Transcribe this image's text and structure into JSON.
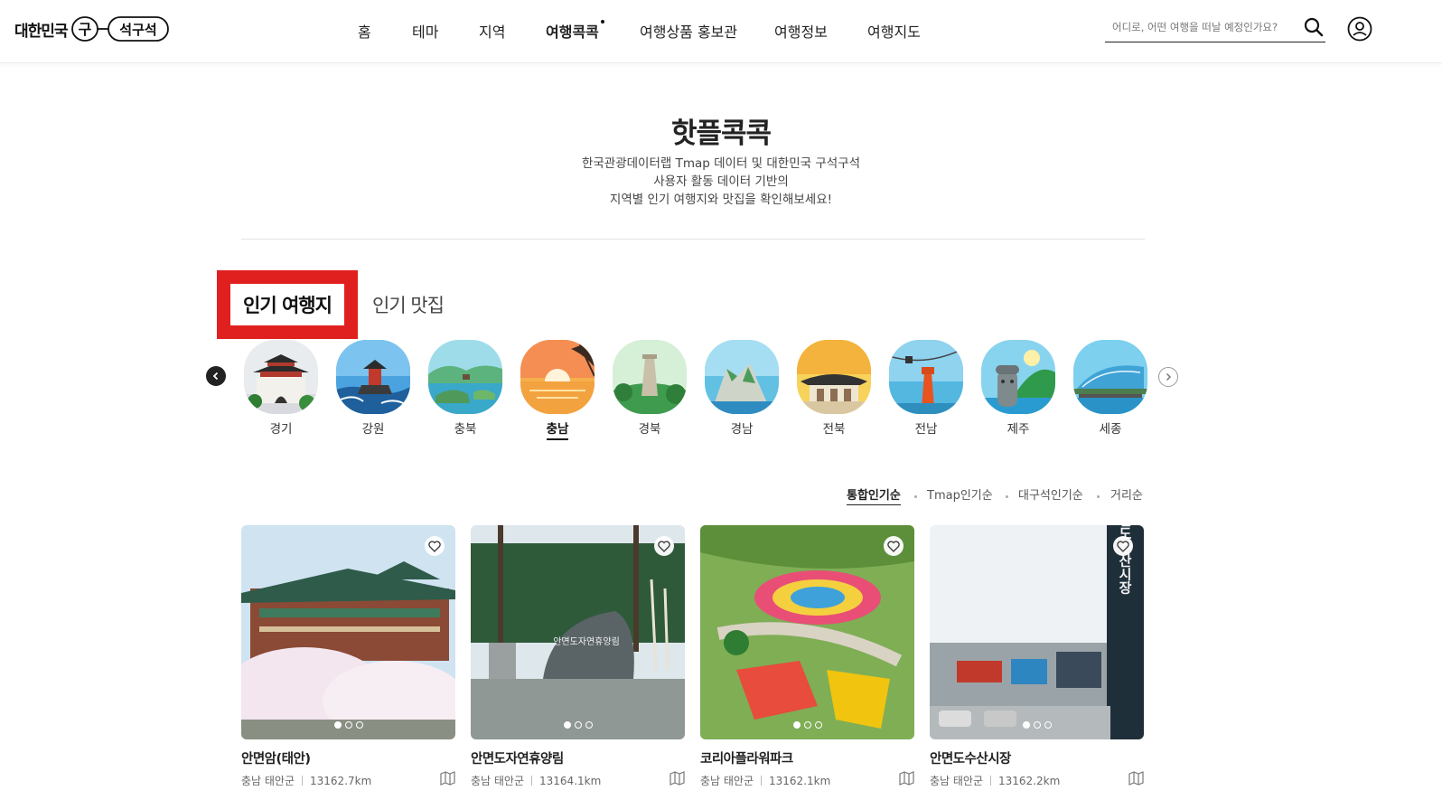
{
  "header": {
    "logo_text": "대한민국",
    "logo_mark_text": "구석구석",
    "nav": [
      {
        "label": "홈",
        "active": false
      },
      {
        "label": "테마",
        "active": false
      },
      {
        "label": "지역",
        "active": false
      },
      {
        "label": "여행콕콕",
        "active": true
      },
      {
        "label": "여행상품 홍보관",
        "active": false
      },
      {
        "label": "여행정보",
        "active": false
      },
      {
        "label": "여행지도",
        "active": false
      }
    ],
    "search_placeholder": "어디로, 어떤 여행을 떠날 예정인가요?",
    "search_value": ""
  },
  "hero": {
    "title": "핫플콕콕",
    "desc_lines": [
      "한국관광데이터랩 Tmap 데이터 및 대한민국 구석구석",
      "사용자 활동 데이터 기반의",
      "지역별 인기 여행지와 맛집을 확인해보세요!"
    ]
  },
  "tabs": {
    "active": "인기 여행지",
    "inactive": "인기 맛집"
  },
  "regions": [
    {
      "label": "경기",
      "active": false
    },
    {
      "label": "강원",
      "active": false
    },
    {
      "label": "충북",
      "active": false
    },
    {
      "label": "충남",
      "active": true
    },
    {
      "label": "경북",
      "active": false
    },
    {
      "label": "경남",
      "active": false
    },
    {
      "label": "전북",
      "active": false
    },
    {
      "label": "전남",
      "active": false
    },
    {
      "label": "제주",
      "active": false
    },
    {
      "label": "세종",
      "active": false
    }
  ],
  "sort": [
    {
      "label": "통합인기순",
      "active": true
    },
    {
      "label": "Tmap인기순",
      "active": false
    },
    {
      "label": "대구석인기순",
      "active": false
    },
    {
      "label": "거리순",
      "active": false
    }
  ],
  "cards": [
    {
      "name": "안면암(태안)",
      "location": "충남 태안군",
      "distance": "13162.7km"
    },
    {
      "name": "안면도자연휴양림",
      "location": "충남 태안군",
      "distance": "13164.1km"
    },
    {
      "name": "코리아플라워파크",
      "location": "충남 태안군",
      "distance": "13162.1km"
    },
    {
      "name": "안면도수산시장",
      "location": "충남 태안군",
      "distance": "13162.2km"
    }
  ],
  "card_image_texts": [
    "",
    "안면도자연휴양림",
    "",
    "안면도수산시장"
  ],
  "colors": {
    "highlight_box": "#e0201f",
    "text_primary": "#222222"
  }
}
